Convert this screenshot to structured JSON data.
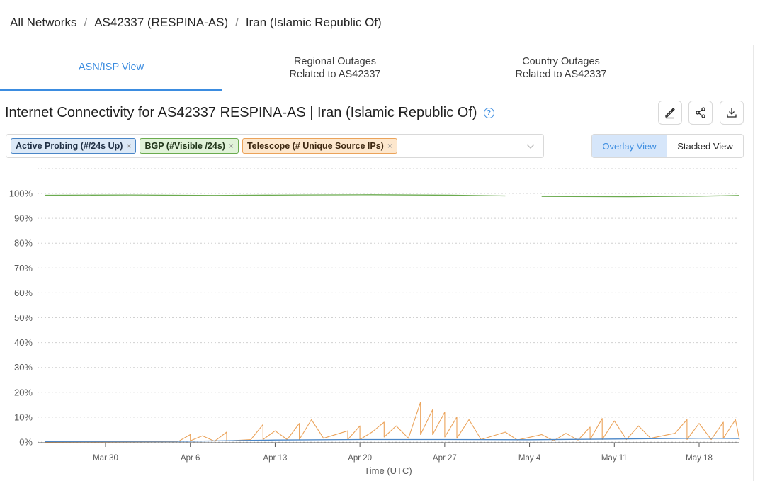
{
  "breadcrumb": {
    "items": [
      "All Networks",
      "AS42337 (RESPINA-AS)",
      "Iran (Islamic Republic Of)"
    ],
    "separator": "/"
  },
  "tabs": [
    {
      "label": "ASN/ISP View",
      "active": true
    },
    {
      "label": "Regional Outages\nRelated to AS42337",
      "active": false
    },
    {
      "label": "Country Outages\nRelated to AS42337",
      "active": false
    }
  ],
  "chart_title": "Internet Connectivity for AS42337 RESPINA-AS | Iran (Islamic Republic Of)",
  "actions": {
    "icons": [
      "edit-icon",
      "share-icon",
      "download-icon"
    ]
  },
  "data_sources": {
    "tags": [
      {
        "label": "Active Probing (#/24s Up)",
        "color": "#4a86c7"
      },
      {
        "label": "BGP (#Visible /24s)",
        "color": "#6bab4f"
      },
      {
        "label": "Telescope (# Unique Source IPs)",
        "color": "#eba35a"
      }
    ],
    "remove_glyph": "×"
  },
  "view_toggle": {
    "overlay": "Overlay View",
    "stacked": "Stacked View",
    "active": "overlay"
  },
  "colors": {
    "accent": "#3b8ce0",
    "active_probing": "#4a86c7",
    "bgp": "#6bab4f",
    "telescope": "#eba35a"
  },
  "chart_data": {
    "type": "line",
    "xlabel": "Time (UTC)",
    "ylabel": "",
    "ylim": [
      0,
      100
    ],
    "yticks": [
      "0%",
      "10%",
      "20%",
      "30%",
      "40%",
      "50%",
      "60%",
      "70%",
      "80%",
      "90%",
      "100%"
    ],
    "x_range_days": [
      "2025-03-25",
      "2025-05-22"
    ],
    "xticks": [
      {
        "label": "Mar 30",
        "date": "2025-03-30"
      },
      {
        "label": "Apr 6",
        "date": "2025-04-06"
      },
      {
        "label": "Apr 13",
        "date": "2025-04-13"
      },
      {
        "label": "Apr 20",
        "date": "2025-04-20"
      },
      {
        "label": "Apr 27",
        "date": "2025-04-27"
      },
      {
        "label": "May 4",
        "date": "2025-05-04"
      },
      {
        "label": "May 11",
        "date": "2025-05-11"
      },
      {
        "label": "May 18",
        "date": "2025-05-18"
      }
    ],
    "grid": true,
    "series": [
      {
        "name": "BGP (#Visible /24s)",
        "color": "#6bab4f",
        "points": [
          [
            "2025-03-25",
            99.3
          ],
          [
            "2025-04-01",
            99.4
          ],
          [
            "2025-04-08",
            99.2
          ],
          [
            "2025-04-15",
            99.4
          ],
          [
            "2025-04-21",
            99.5
          ],
          [
            "2025-04-28",
            99.3
          ],
          [
            "2025-05-02",
            99.0
          ],
          [
            "2025-05-04",
            null
          ],
          [
            "2025-05-05",
            98.8
          ],
          [
            "2025-05-12",
            98.7
          ],
          [
            "2025-05-18",
            98.9
          ],
          [
            "2025-05-22",
            99.2
          ]
        ]
      },
      {
        "name": "Active Probing (#/24s Up)",
        "color": "#4a86c7",
        "points": [
          [
            "2025-03-25",
            0.2
          ],
          [
            "2025-04-06",
            0.3
          ],
          [
            "2025-04-13",
            0.8
          ],
          [
            "2025-04-20",
            1.0
          ],
          [
            "2025-04-27",
            1.0
          ],
          [
            "2025-05-04",
            0.9
          ],
          [
            "2025-05-11",
            1.2
          ],
          [
            "2025-05-18",
            1.5
          ],
          [
            "2025-05-22",
            1.4
          ]
        ]
      },
      {
        "name": "Telescope (# Unique Source IPs)",
        "color": "#eba35a",
        "points": [
          [
            "2025-03-25",
            0
          ],
          [
            "2025-04-05",
            0.2
          ],
          [
            "2025-04-06",
            3.0
          ],
          [
            "2025-04-06",
            0.5
          ],
          [
            "2025-04-07",
            2.5
          ],
          [
            "2025-04-08",
            0.3
          ],
          [
            "2025-04-09",
            4.0
          ],
          [
            "2025-04-09",
            0.4
          ],
          [
            "2025-04-11",
            1.0
          ],
          [
            "2025-04-12",
            7.0
          ],
          [
            "2025-04-12",
            1.0
          ],
          [
            "2025-04-13",
            4.5
          ],
          [
            "2025-04-14",
            1.0
          ],
          [
            "2025-04-15",
            7.5
          ],
          [
            "2025-04-15",
            1.0
          ],
          [
            "2025-04-16",
            9.0
          ],
          [
            "2025-04-17",
            1.5
          ],
          [
            "2025-04-19",
            4.5
          ],
          [
            "2025-04-19",
            1.0
          ],
          [
            "2025-04-20",
            6.5
          ],
          [
            "2025-04-20",
            1.0
          ],
          [
            "2025-04-21",
            4.0
          ],
          [
            "2025-04-22",
            8.0
          ],
          [
            "2025-04-22",
            2.0
          ],
          [
            "2025-04-23",
            6.5
          ],
          [
            "2025-04-24",
            1.5
          ],
          [
            "2025-04-25",
            16.0
          ],
          [
            "2025-04-25",
            3.0
          ],
          [
            "2025-04-26",
            13.0
          ],
          [
            "2025-04-26",
            3.0
          ],
          [
            "2025-04-27",
            12.0
          ],
          [
            "2025-04-27",
            2.0
          ],
          [
            "2025-04-28",
            10.0
          ],
          [
            "2025-04-28",
            1.5
          ],
          [
            "2025-04-29",
            9.0
          ],
          [
            "2025-04-30",
            1.0
          ],
          [
            "2025-05-02",
            4.0
          ],
          [
            "2025-05-03",
            0.8
          ],
          [
            "2025-05-05",
            3.0
          ],
          [
            "2025-05-06",
            0.5
          ],
          [
            "2025-05-07",
            3.5
          ],
          [
            "2025-05-08",
            0.8
          ],
          [
            "2025-05-09",
            6.0
          ],
          [
            "2025-05-09",
            1.0
          ],
          [
            "2025-05-10",
            9.5
          ],
          [
            "2025-05-10",
            1.0
          ],
          [
            "2025-05-11",
            8.5
          ],
          [
            "2025-05-12",
            1.0
          ],
          [
            "2025-05-13",
            6.5
          ],
          [
            "2025-05-14",
            1.5
          ],
          [
            "2025-05-16",
            3.5
          ],
          [
            "2025-05-17",
            9.0
          ],
          [
            "2025-05-17",
            1.0
          ],
          [
            "2025-05-18",
            7.5
          ],
          [
            "2025-05-19",
            1.0
          ],
          [
            "2025-05-20",
            8.0
          ],
          [
            "2025-05-20",
            1.5
          ],
          [
            "2025-05-21",
            9.0
          ],
          [
            "2025-05-22",
            1.0
          ]
        ]
      }
    ]
  }
}
